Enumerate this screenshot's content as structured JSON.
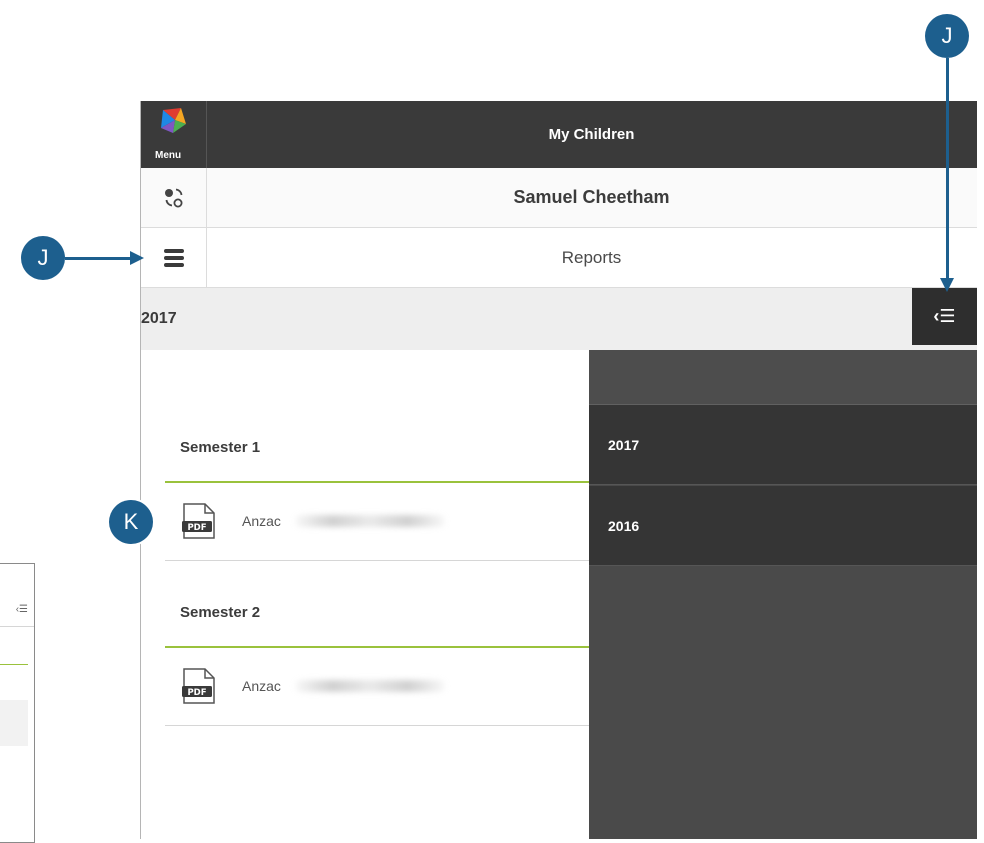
{
  "app": {
    "menu_label": "Menu",
    "title": "My Children"
  },
  "student": {
    "name": "Samuel Cheetham"
  },
  "section": {
    "title": "Reports"
  },
  "filter": {
    "selected_year": "2017"
  },
  "reports": [
    {
      "semester": "Semester 1",
      "file_label": "Anzac",
      "file_type": "PDF"
    },
    {
      "semester": "Semester 2",
      "file_label": "Anzac",
      "file_type": "PDF"
    }
  ],
  "year_panel": {
    "years": [
      "2017",
      "2016"
    ]
  },
  "callouts": {
    "j": "J",
    "k": "K"
  },
  "colors": {
    "topbar": "#3a3a3a",
    "panel": "#353535",
    "accent_green": "#9ac23c",
    "callout_blue": "#1d5f8e"
  },
  "icons": {
    "menu": "app-logo-icon",
    "student_switch": "switch-student-icon",
    "nav": "hamburger-icon",
    "filter": "filter-panel-icon",
    "file": "pdf-file-icon"
  }
}
